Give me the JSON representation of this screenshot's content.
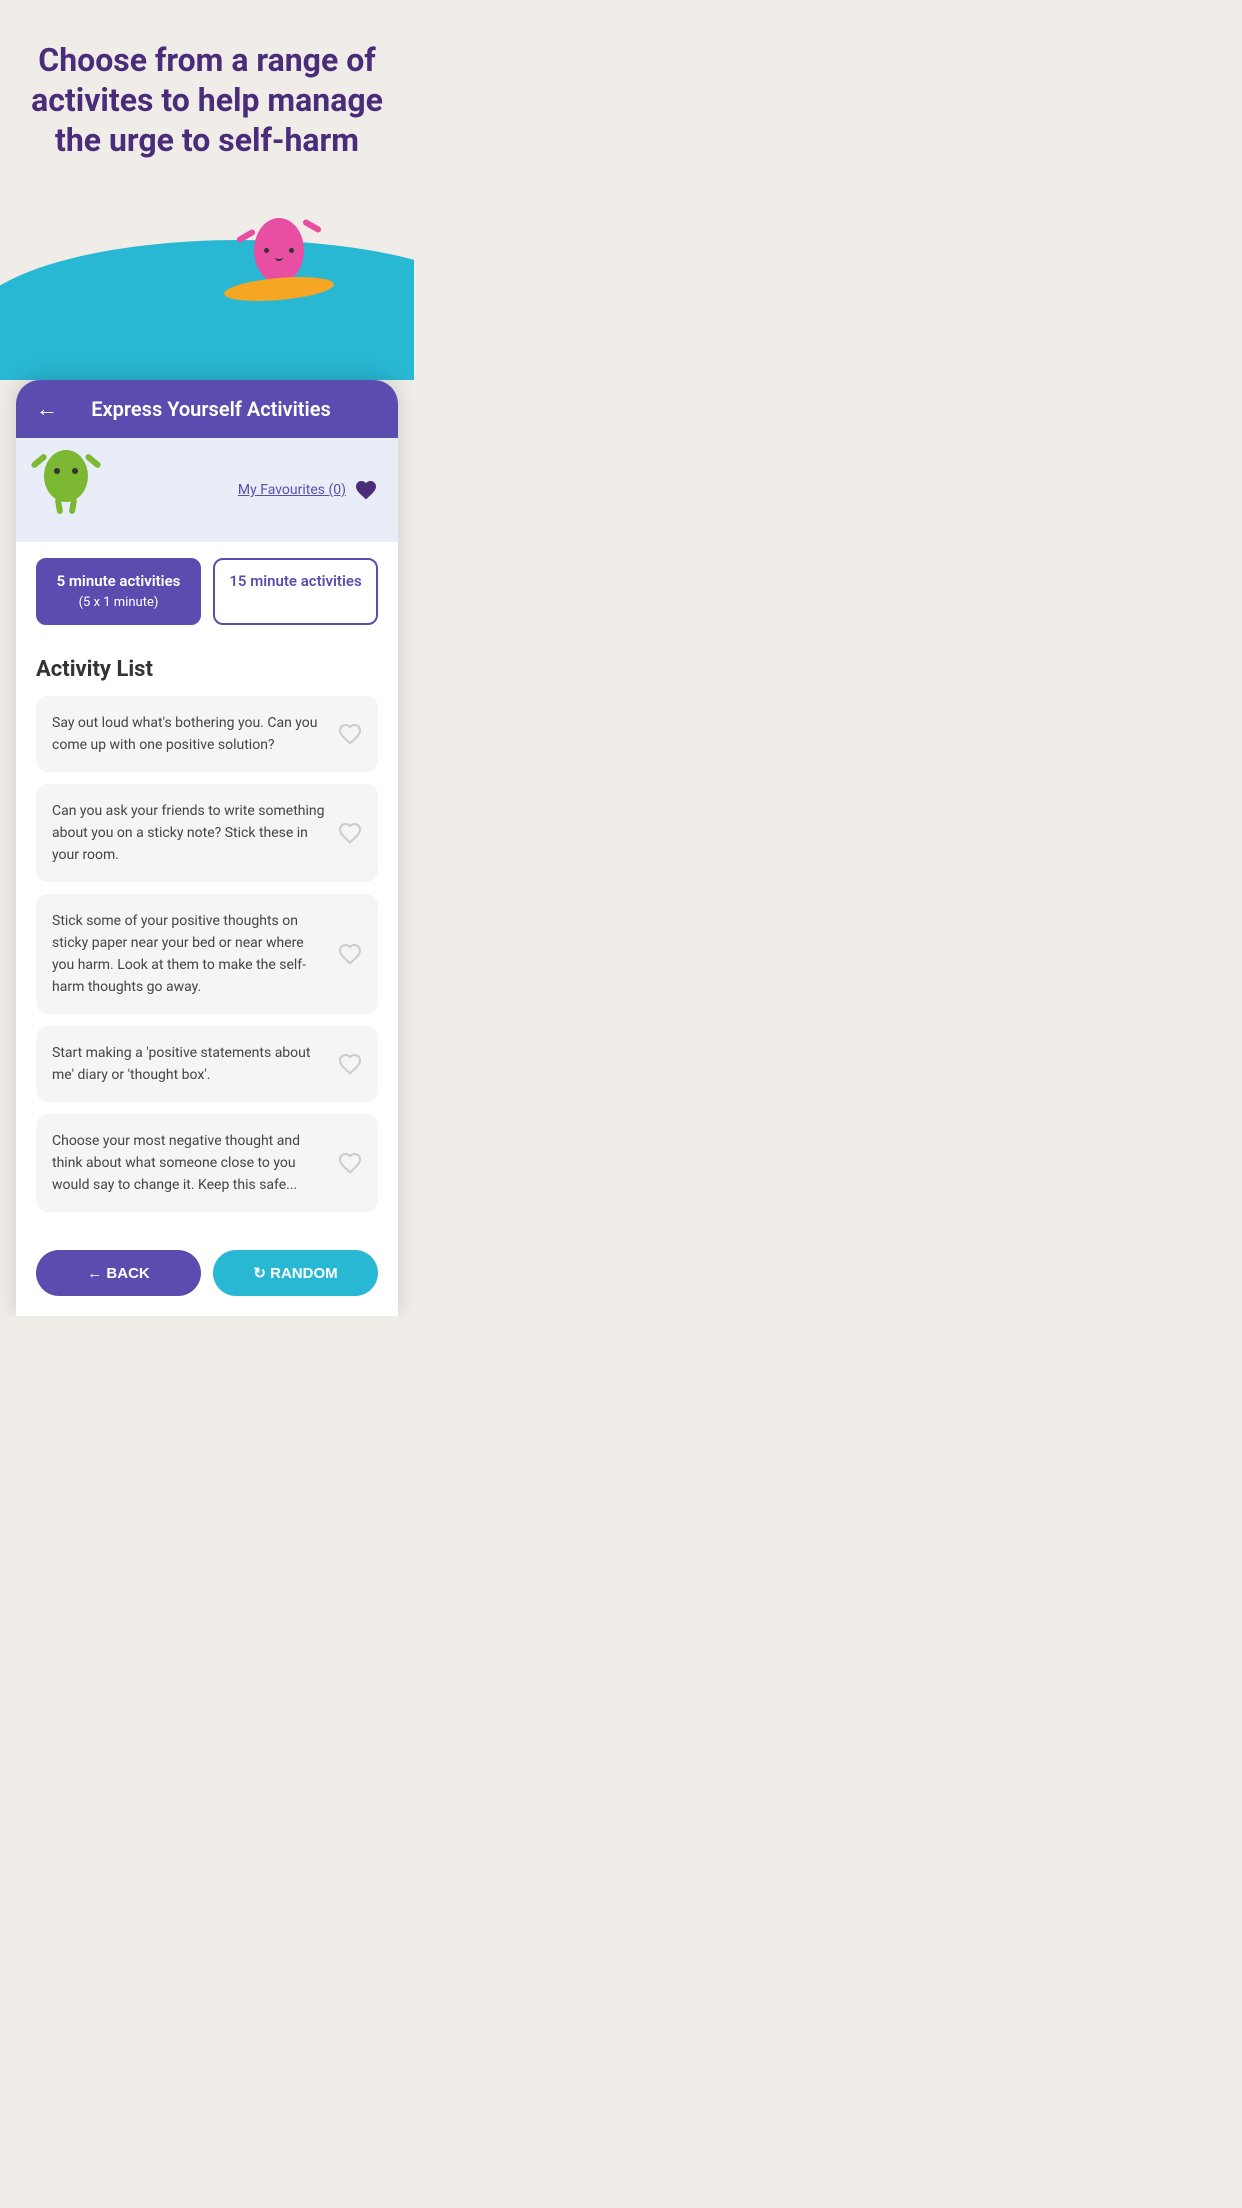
{
  "hero": {
    "title": "Choose from a range of activites to help manage the urge to self-harm"
  },
  "app": {
    "header_title": "Express Yourself Activities",
    "back_label": "←",
    "favourites_label": "My Favourites (0)",
    "tab_active_label": "5 minute activities",
    "tab_active_sublabel": "(5 x 1 minute)",
    "tab_inactive_label": "15 minute activities",
    "activity_list_title": "Activity List",
    "activities": [
      {
        "text": "Say out loud what's bothering you. Can you come up with one positive solution?"
      },
      {
        "text": "Can you ask your friends to write something about you on a sticky note? Stick these in your room."
      },
      {
        "text": "Stick some of your positive thoughts on sticky paper near your bed or near where you harm. Look at them to make the self-harm thoughts go away."
      },
      {
        "text": "Start making a 'positive statements about me' diary or 'thought box'."
      },
      {
        "text": "Choose your most negative thought and think about what someone close to you would say to change it. Keep this safe..."
      }
    ],
    "bottom_back_label": "← BACK",
    "bottom_random_label": "↻ RANDOM"
  },
  "colors": {
    "purple_dark": "#4a2d7a",
    "purple_medium": "#5b4db0",
    "blue_wave": "#29b8d4",
    "bg_light": "#f0ede8",
    "green_char": "#7cb832",
    "pink_surfer": "#e84fa3",
    "orange_board": "#f5a623"
  }
}
